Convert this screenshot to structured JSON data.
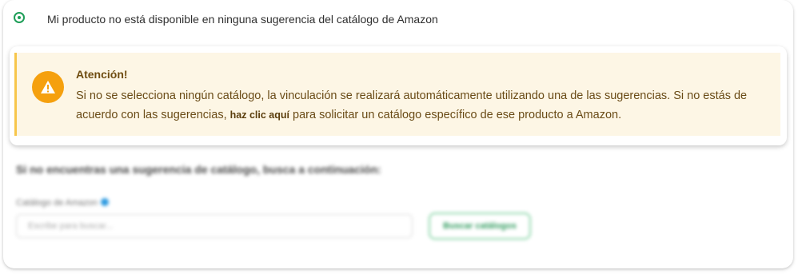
{
  "option": {
    "label": "Mi producto no está disponible en ninguna sugerencia del catálogo de Amazon",
    "selected": true,
    "accent_color": "#1e9e58"
  },
  "alert": {
    "title": "Atención!",
    "body_before": "Si no se selecciona ningún catálogo, la vinculación se realizará automáticamente utilizando una de las sugerencias. Si no estás de acuerdo con las sugerencias, ",
    "link_text": "haz clic aquí",
    "body_after": " para solicitar un catálogo específico de ese producto a Amazon.",
    "icon": "warning-icon",
    "icon_color": "#f5a00e",
    "background_color": "#fdf6e5"
  },
  "search_section": {
    "heading": "Si no encuentras una sugerencia de catálogo, busca a continuación:",
    "field_label": "Catálogo de Amazon",
    "field_icon": "info-icon",
    "input_placeholder": "Escribe para buscar...",
    "button_label": "Buscar catálogos"
  }
}
